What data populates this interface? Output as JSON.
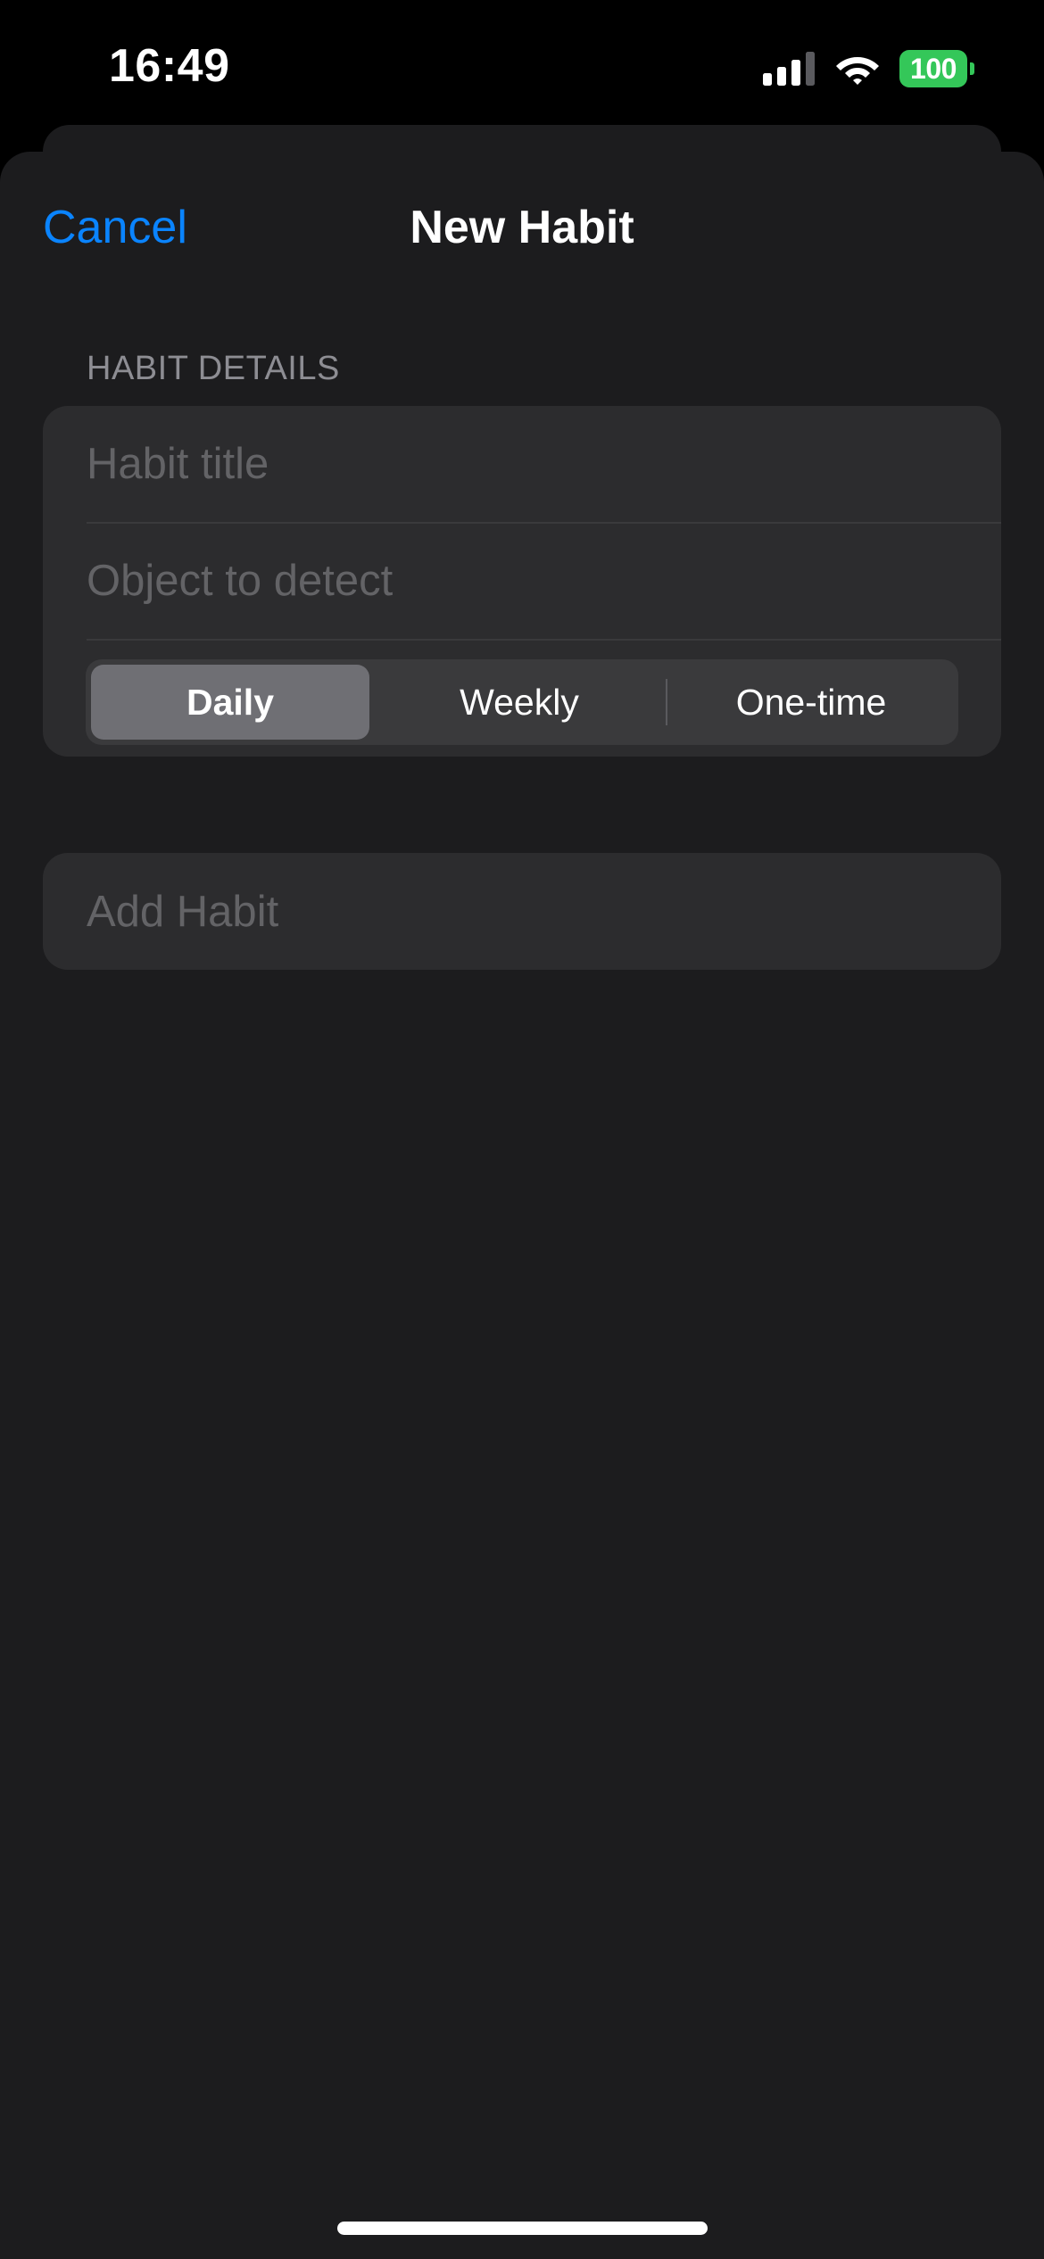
{
  "status_bar": {
    "time": "16:49",
    "battery_level": "100",
    "signal_icon": "cellular-signal-icon",
    "wifi_icon": "wifi-icon",
    "battery_color": "#34c759"
  },
  "nav": {
    "cancel_label": "Cancel",
    "title": "New Habit"
  },
  "form": {
    "section_header": "HABIT DETAILS",
    "title_field": {
      "placeholder": "Habit title",
      "value": ""
    },
    "object_field": {
      "placeholder": "Object to detect",
      "value": ""
    },
    "frequency": {
      "options": [
        "Daily",
        "Weekly",
        "One-time"
      ],
      "selected": "Daily"
    }
  },
  "add_button": {
    "label": "Add Habit"
  },
  "colors": {
    "accent": "#0a84ff",
    "background": "#1c1c1e",
    "grouped_row": "#2c2c2e",
    "placeholder": "#636366"
  }
}
